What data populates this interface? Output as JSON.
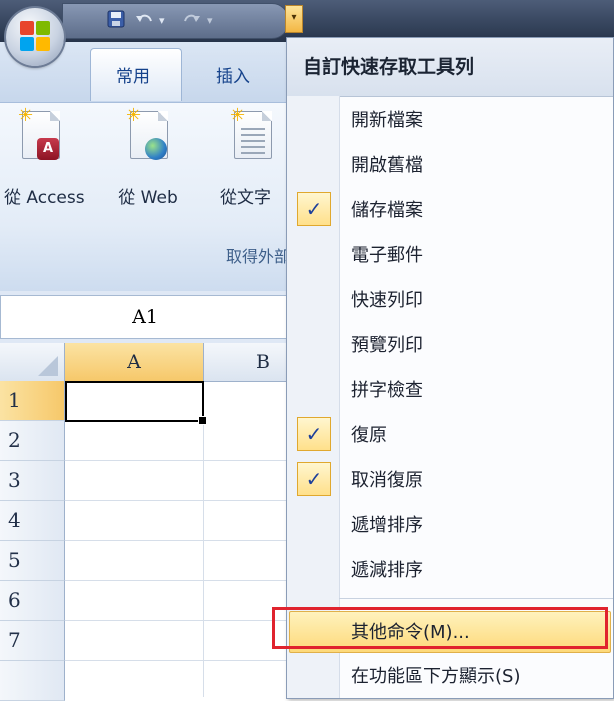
{
  "qat": {
    "save_icon": "save-icon",
    "undo_icon": "undo-icon",
    "redo_icon": "redo-icon",
    "customize_icon": "chevron-down-icon"
  },
  "tabs": [
    {
      "label": "常用",
      "active": true
    },
    {
      "label": "插入",
      "active": false
    }
  ],
  "ribbon": {
    "buttons": [
      {
        "label": "從 Access",
        "icon": "access-database-icon"
      },
      {
        "label": "從 Web",
        "icon": "web-globe-icon"
      },
      {
        "label": "從文字",
        "icon": "text-file-icon"
      }
    ],
    "group_label": "取得外部"
  },
  "namebox": {
    "value": "A1"
  },
  "grid": {
    "columns": [
      "A",
      "B"
    ],
    "rows": [
      "1",
      "2",
      "3",
      "4",
      "5",
      "6",
      "7"
    ]
  },
  "menu": {
    "title": "自訂快速存取工具列",
    "items": [
      {
        "label": "開新檔案",
        "checked": false
      },
      {
        "label": "開啟舊檔",
        "checked": false
      },
      {
        "label": "儲存檔案",
        "checked": true
      },
      {
        "label": "電子郵件",
        "checked": false
      },
      {
        "label": "快速列印",
        "checked": false
      },
      {
        "label": "預覽列印",
        "checked": false
      },
      {
        "label": "拼字檢查",
        "checked": false
      },
      {
        "label": "復原",
        "checked": true
      },
      {
        "label": "取消復原",
        "checked": true
      },
      {
        "label": "遞增排序",
        "checked": false
      },
      {
        "label": "遞減排序",
        "checked": false
      }
    ],
    "more_commands": "其他命令(M)...",
    "show_below": "在功能區下方顯示(S)",
    "check_glyph": "✓"
  },
  "colors": {
    "highlight": "#fdd979",
    "annotation_red": "#e0232e",
    "check_blue": "#1d3f9a"
  }
}
